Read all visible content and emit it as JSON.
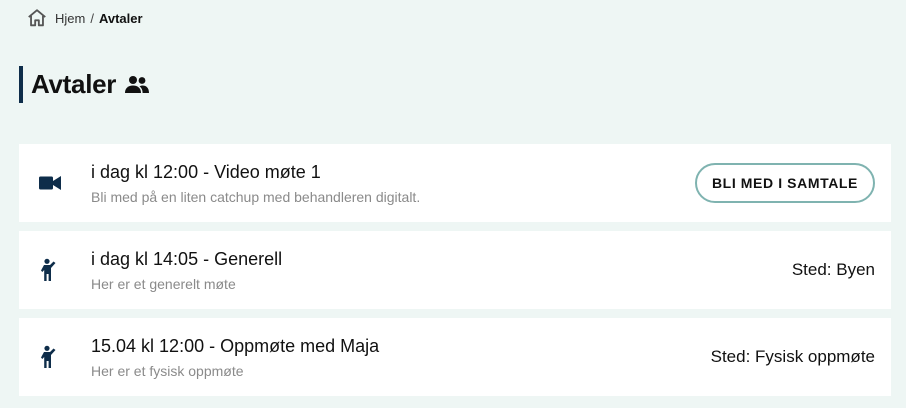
{
  "breadcrumb": {
    "home_icon": "home-icon",
    "home_label": "Hjem",
    "separator": "/",
    "current_label": "Avtaler"
  },
  "page": {
    "title": "Avtaler",
    "title_icon": "people-icon"
  },
  "appointments": [
    {
      "icon": "video-camera-icon",
      "title": "i dag kl 12:00 - Video møte 1",
      "subtitle": "Bli med på en liten catchup med behandleren digitalt.",
      "action_label": "BLI MED I SAMTALE"
    },
    {
      "icon": "person-waving-icon",
      "title": "i dag kl 14:05 - Generell",
      "subtitle": "Her er et generelt møte",
      "location": "Sted: Byen"
    },
    {
      "icon": "person-waving-icon",
      "title": "15.04 kl 12:00 - Oppmøte med Maja",
      "subtitle": "Her er et fysisk oppmøte",
      "location": "Sted: Fysisk oppmøte"
    }
  ],
  "colors": {
    "background": "#eef6f4",
    "card": "#ffffff",
    "accent_navy": "#0e2d4a",
    "button_border": "#7fb3b0",
    "muted_text": "#8a8a8a"
  }
}
